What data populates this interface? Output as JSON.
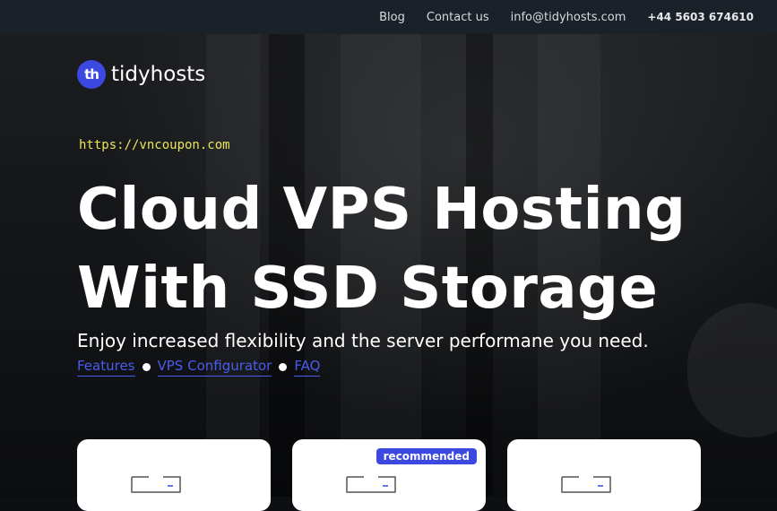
{
  "topbar": {
    "links": [
      {
        "label": "Blog"
      },
      {
        "label": "Contact us"
      },
      {
        "label": "info@tidyhosts.com"
      }
    ],
    "phone": "+44 5603 674610"
  },
  "logo": {
    "mark": "th",
    "text": "tidyhosts"
  },
  "watermark": "https://vncoupon.com",
  "hero": {
    "headline_line1": "Cloud VPS Hosting",
    "headline_line2": "With SSD Storage",
    "subline": "Enjoy increased flexibility and the server performane you need.",
    "quicklinks": [
      {
        "label": "Features"
      },
      {
        "label": "VPS Configurator"
      },
      {
        "label": "FAQ"
      }
    ]
  },
  "cards": [
    {
      "icon": "server-icon"
    },
    {
      "icon": "server-icon",
      "badge": "recommended"
    },
    {
      "icon": "server-icon"
    }
  ],
  "colors": {
    "accent": "#3b49e0",
    "link": "#4a5cf0",
    "topbar_bg": "#1b2129",
    "watermark": "#ece55a"
  }
}
